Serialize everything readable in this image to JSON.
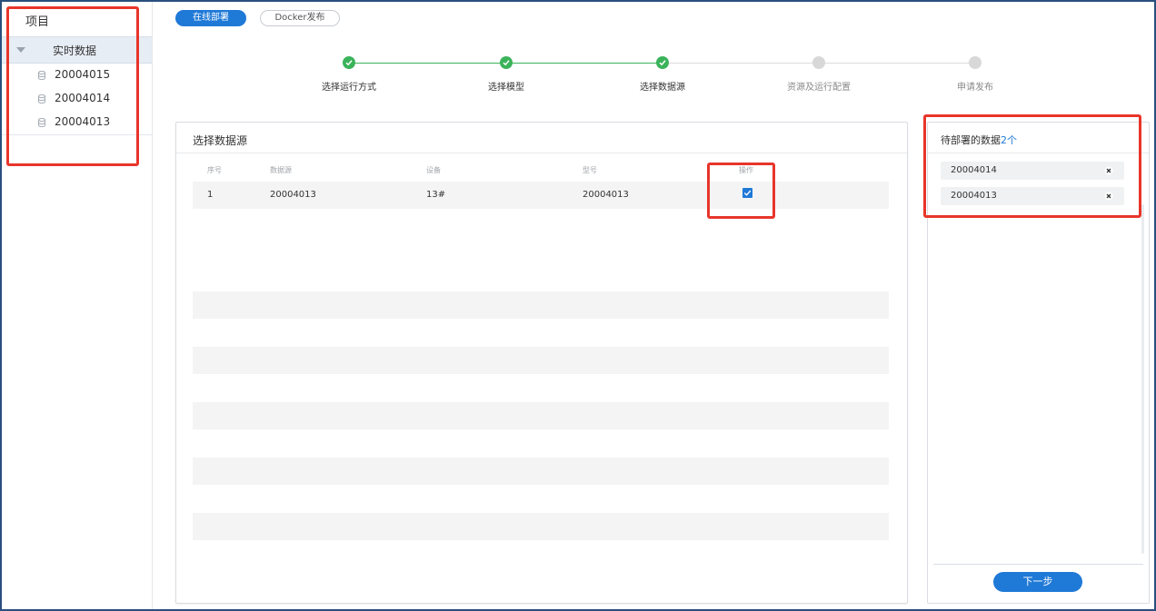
{
  "sidebar": {
    "title": "项目",
    "group_label": "实时数据",
    "items": [
      {
        "label": "20004015"
      },
      {
        "label": "20004014"
      },
      {
        "label": "20004013"
      }
    ]
  },
  "tabs": [
    {
      "label": "在线部署",
      "active": true
    },
    {
      "label": "Docker发布",
      "active": false
    }
  ],
  "steps": [
    {
      "label": "选择运行方式",
      "status": "done"
    },
    {
      "label": "选择模型",
      "status": "done"
    },
    {
      "label": "选择数据源",
      "status": "done"
    },
    {
      "label": "资源及运行配置",
      "status": "pending"
    },
    {
      "label": "申请发布",
      "status": "pending"
    }
  ],
  "main": {
    "title": "选择数据源",
    "columns": [
      "序号",
      "数据源",
      "设备",
      "型号",
      "操作"
    ],
    "rows": [
      {
        "index": "1",
        "source": "20004013",
        "device": "13#",
        "model": "20004013",
        "checked": true
      }
    ]
  },
  "right": {
    "title": "待部署的数据",
    "count": "2个",
    "items": [
      {
        "label": "20004014"
      },
      {
        "label": "20004013"
      }
    ],
    "next_label": "下一步"
  },
  "colors": {
    "accent": "#1f79d7",
    "done": "#3bb35a",
    "pending": "#d8d8d8",
    "highlight": "#e8352b"
  }
}
